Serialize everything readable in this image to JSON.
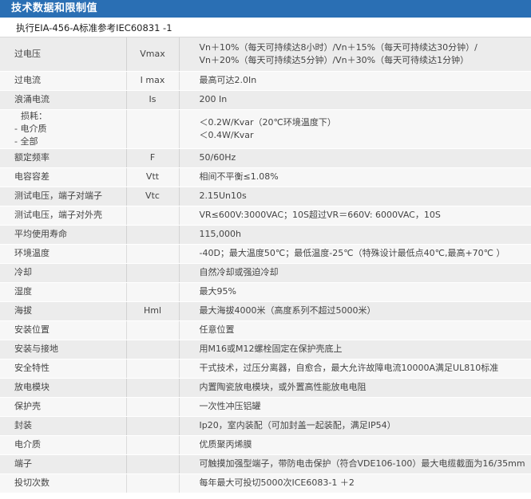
{
  "title": "技术数据和限制值",
  "subtitle": "执行EIA-456-A标准参考IEC60831 -1",
  "rows": [
    {
      "name": [
        "过电压"
      ],
      "symbol": "Vmax",
      "value": [
        "Vn＋10%（每天可持续达8小时）/Vn＋15%（每天可持续达30分钟）/",
        "Vn＋20%（每天可持续达5分钟）/Vn＋30%（每天可待续达1分钟）"
      ]
    },
    {
      "name": [
        "过电流"
      ],
      "symbol": "I max",
      "value": [
        "最高可达2.0In"
      ]
    },
    {
      "name": [
        "浪涌电流"
      ],
      "symbol": "Is",
      "value": [
        "200 In"
      ]
    },
    {
      "name": [
        "损耗：",
        "- 电介质",
        "- 全部"
      ],
      "symbol": "",
      "value": [
        "＜0.2W/Kvar（20℃环境温度下）",
        "＜0.4W/Kvar"
      ]
    },
    {
      "name": [
        "额定频率"
      ],
      "symbol": "F",
      "value": [
        "50/60Hz"
      ]
    },
    {
      "name": [
        "电容容差"
      ],
      "symbol": "Vtt",
      "value": [
        "相间不平衡≤1.08%"
      ]
    },
    {
      "name": [
        "测试电压，端子对端子"
      ],
      "symbol": "Vtc",
      "value": [
        "2.15Un10s"
      ]
    },
    {
      "name": [
        "测试电压，端子对外壳"
      ],
      "symbol": "",
      "value": [
        "VR≤600V:3000VAC；10S超过VR＝660V: 6000VAC，10S"
      ]
    },
    {
      "name": [
        "平均使用寿命"
      ],
      "symbol": "",
      "value": [
        "115,000h"
      ]
    },
    {
      "name": [
        "环境温度"
      ],
      "symbol": "",
      "value": [
        "-40D；最大温度50℃；最低温度-25℃（特殊设计最低点40℃,最高+70℃ ）"
      ]
    },
    {
      "name": [
        "冷却"
      ],
      "symbol": "",
      "value": [
        "自然冷却或强迫冷却"
      ]
    },
    {
      "name": [
        "湿度"
      ],
      "symbol": "",
      "value": [
        "最大95%"
      ]
    },
    {
      "name": [
        "海拔"
      ],
      "symbol": "Hml",
      "value": [
        "最大海拔4000米（高度系列不超过5000米）"
      ]
    },
    {
      "name": [
        "安装位置"
      ],
      "symbol": "",
      "value": [
        "任意位置"
      ]
    },
    {
      "name": [
        "安装与接地"
      ],
      "symbol": "",
      "value": [
        "用M16或M12螺栓固定在保护壳底上"
      ]
    },
    {
      "name": [
        "安全特性"
      ],
      "symbol": "",
      "value": [
        "干式技术，过压分离器，自愈合，最大允许故障电流10000A满足UL810标准"
      ]
    },
    {
      "name": [
        "放电模块"
      ],
      "symbol": "",
      "value": [
        "内置陶瓷放电模块，或外置高性能放电电阻"
      ]
    },
    {
      "name": [
        "保护壳"
      ],
      "symbol": "",
      "value": [
        "一次性冲压铝罐"
      ]
    },
    {
      "name": [
        "封装"
      ],
      "symbol": "",
      "value": [
        "Ip20，室内装配（可加封盖一起装配，满足IP54）"
      ]
    },
    {
      "name": [
        "电介质"
      ],
      "symbol": "",
      "value": [
        "优质聚丙烯膜"
      ]
    },
    {
      "name": [
        "端子"
      ],
      "symbol": "",
      "value": [
        "可触摸加强型端子，带防电击保护（符合VDE106-100）最大电缆截面为16/35mm"
      ]
    },
    {
      "name": [
        "投切次数"
      ],
      "symbol": "",
      "value": [
        "每年最大可投切5000次ICE6083-1 ＋2"
      ]
    }
  ]
}
